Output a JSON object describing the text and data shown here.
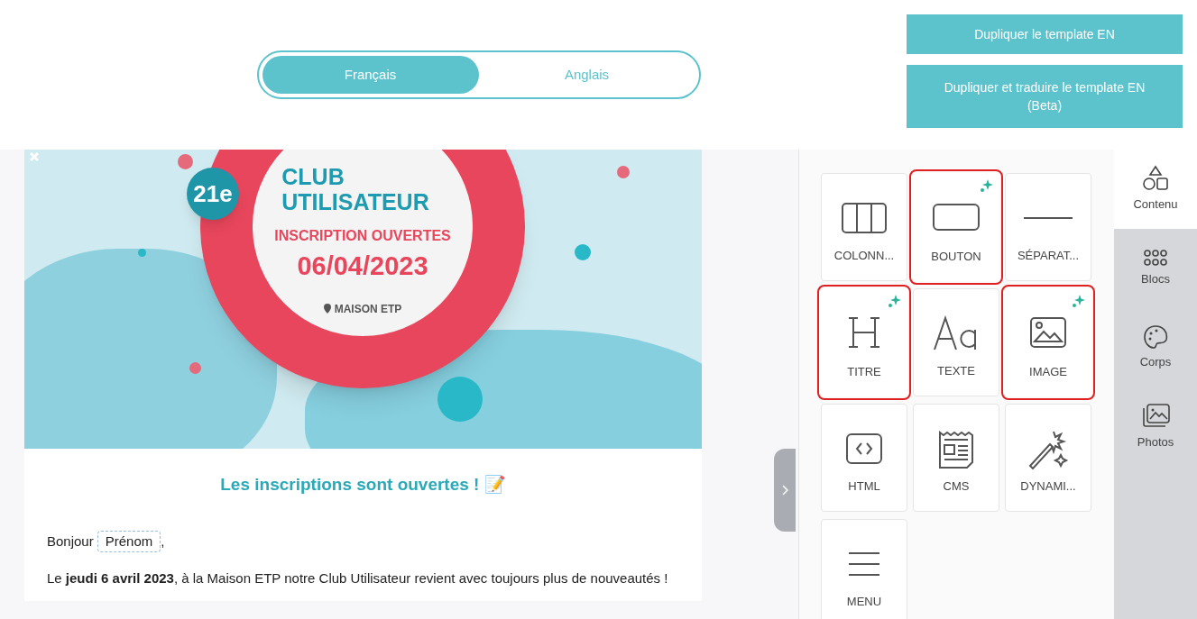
{
  "language_toggle": [
    {
      "label": "Français",
      "selected": true
    },
    {
      "label": "Anglais",
      "selected": false
    }
  ],
  "actions": [
    "Dupliquer le template EN",
    "Dupliquer et traduire le template EN (Beta)"
  ],
  "banner": {
    "badge": "21e",
    "title_1": "CLUB",
    "title_2": "UTILISATEUR",
    "subtitle": "INSCRIPTION OUVERTES",
    "date": "06/04/2023",
    "place": "MAISON ETP"
  },
  "email": {
    "heading": "Les inscriptions sont ouvertes ! 📝",
    "greeting": "Bonjour",
    "merge_tag": "Prénom",
    "greeting_end": ",",
    "paragraph": "Le **jeudi 6 avril 2023**, à la Maison ETP notre Club Utilisateur revient avec toujours plus de nouveautés !"
  },
  "tiles": [
    {
      "kind": "columns",
      "label": "COLONN...",
      "highlighted": false,
      "new": false
    },
    {
      "kind": "button",
      "label": "BOUTON",
      "highlighted": true,
      "new": true
    },
    {
      "kind": "divider",
      "label": "SÉPARAT...",
      "highlighted": false,
      "new": false
    },
    {
      "kind": "heading",
      "label": "TITRE",
      "highlighted": true,
      "new": true
    },
    {
      "kind": "text",
      "label": "TEXTE",
      "highlighted": false,
      "new": false
    },
    {
      "kind": "image",
      "label": "IMAGE",
      "highlighted": true,
      "new": true
    },
    {
      "kind": "html",
      "label": "HTML",
      "highlighted": false,
      "new": false
    },
    {
      "kind": "cms",
      "label": "CMS",
      "highlighted": false,
      "new": false
    },
    {
      "kind": "dynamic",
      "label": "DYNAMI...",
      "highlighted": false,
      "new": false
    },
    {
      "kind": "menu",
      "label": "MENU",
      "highlighted": false,
      "new": false
    }
  ],
  "sidebar_tabs": [
    {
      "kind": "content",
      "label": "Contenu",
      "selected": true
    },
    {
      "kind": "blocks",
      "label": "Blocs",
      "selected": false
    },
    {
      "kind": "body",
      "label": "Corps",
      "selected": false
    },
    {
      "kind": "photos",
      "label": "Photos",
      "selected": false
    }
  ]
}
